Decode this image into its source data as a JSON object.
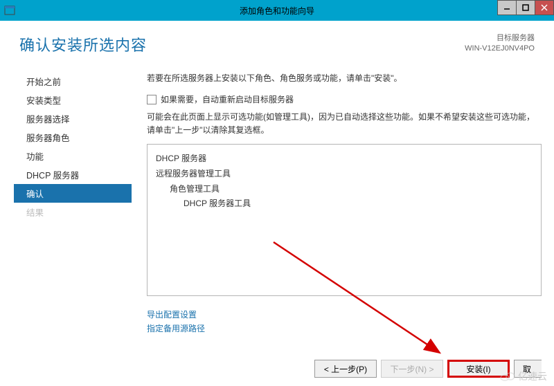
{
  "titlebar": {
    "title": "添加角色和功能向导"
  },
  "header": {
    "page_title": "确认安装所选内容",
    "target_label": "目标服务器",
    "target_server": "WIN-V12EJ0NV4PO"
  },
  "sidebar": {
    "items": [
      {
        "label": "开始之前",
        "state": "normal"
      },
      {
        "label": "安装类型",
        "state": "normal"
      },
      {
        "label": "服务器选择",
        "state": "normal"
      },
      {
        "label": "服务器角色",
        "state": "normal"
      },
      {
        "label": "功能",
        "state": "normal"
      },
      {
        "label": "DHCP 服务器",
        "state": "normal"
      },
      {
        "label": "确认",
        "state": "selected"
      },
      {
        "label": "结果",
        "state": "disabled"
      }
    ]
  },
  "content": {
    "intro": "若要在所选服务器上安装以下角色、角色服务或功能，请单击\"安装\"。",
    "restart_checkbox_label": "如果需要，自动重新启动目标服务器",
    "note": "可能会在此页面上显示可选功能(如管理工具)，因为已自动选择这些功能。如果不希望安装这些可选功能，请单击\"上一步\"以清除其复选框。",
    "features": [
      {
        "text": "DHCP 服务器",
        "indent": 0
      },
      {
        "text": "远程服务器管理工具",
        "indent": 0
      },
      {
        "text": "角色管理工具",
        "indent": 1
      },
      {
        "text": "DHCP 服务器工具",
        "indent": 2
      }
    ],
    "links": {
      "export": "导出配置设置",
      "alt_source": "指定备用源路径"
    }
  },
  "buttons": {
    "previous": "< 上一步(P)",
    "next": "下一步(N) >",
    "install": "安装(I)",
    "cancel": "取"
  },
  "watermark": "亿速云"
}
